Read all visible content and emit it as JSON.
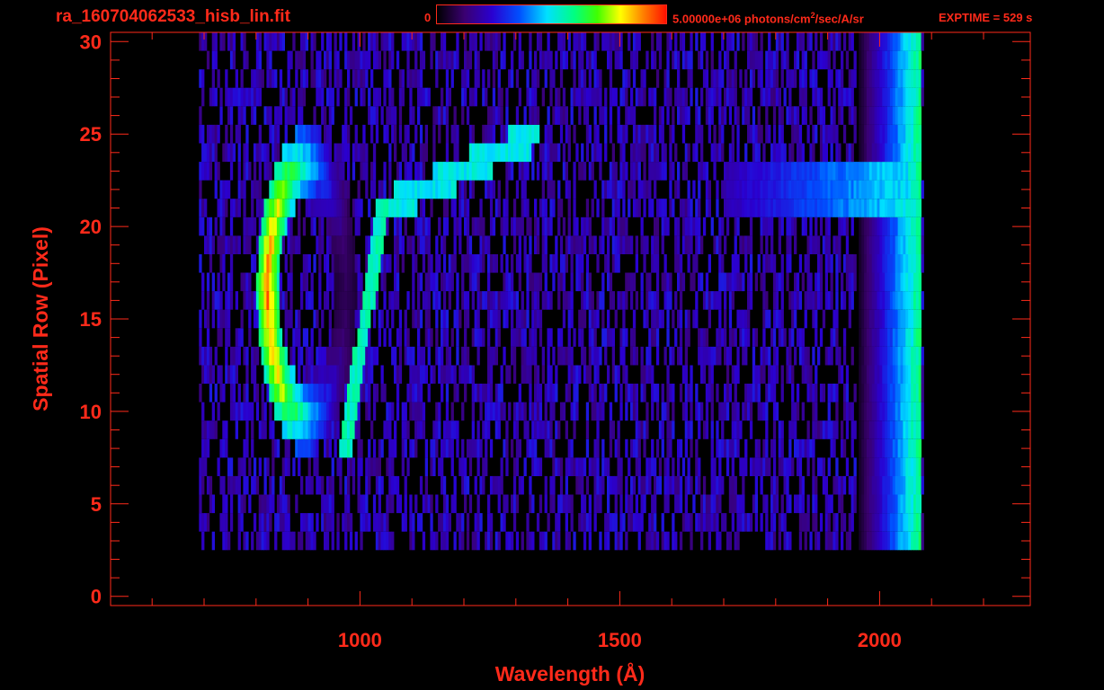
{
  "header": {
    "file_title": "ra_160704062533_hisb_lin.fit",
    "colorbar_min": "0",
    "colorbar_max_prefix": "5.00000e+06 photons/cm",
    "colorbar_max_sup": "2",
    "colorbar_max_suffix": "/sec/A/sr",
    "exptime": "EXPTIME = 529 s"
  },
  "colors": {
    "axis": "#ff2a1a",
    "background": "#000000",
    "colormap": [
      "#000000",
      "#3a0070",
      "#2a00d0",
      "#0050ff",
      "#00e0ff",
      "#00ff80",
      "#40ff00",
      "#ffff00",
      "#ff8000",
      "#ff1000"
    ]
  },
  "chart_data": {
    "type": "heatmap",
    "title": "ra_160704062533_hisb_lin.fit",
    "xlabel": "Wavelength (Å)",
    "ylabel": "Spatial Row (Pixel)",
    "xlim": [
      520,
      2290
    ],
    "ylim": [
      -0.5,
      30.5
    ],
    "xticks": [
      1000,
      1500,
      2000
    ],
    "yticks": [
      0,
      5,
      10,
      15,
      20,
      25,
      30
    ],
    "colorbar": {
      "min": 0,
      "max": 5000000,
      "units": "photons/cm^2/sec/A/sr"
    },
    "data_extent": {
      "wavelength": [
        690,
        2080
      ],
      "rows": [
        3,
        30
      ]
    },
    "emission_features": [
      {
        "name": "loop",
        "wavelength_center": 895,
        "row_center": 16.5,
        "row_span": [
          10,
          24
        ],
        "peak_level": 0.95
      },
      {
        "name": "diagonal-streak",
        "wavelength": [
          970,
          1040
        ],
        "rows": [
          8,
          21
        ],
        "peak_level": 0.55
      },
      {
        "name": "upper-band",
        "wavelength": [
          1050,
          1340
        ],
        "rows": [
          21,
          25
        ],
        "peak_level": 0.5
      },
      {
        "name": "row-22-band",
        "wavelength": [
          1700,
          2060
        ],
        "rows": [
          21,
          23
        ],
        "peak_level": 0.5
      },
      {
        "name": "red-edge",
        "wavelength": [
          1950,
          2075
        ],
        "rows": [
          0,
          30
        ],
        "peak_level": 0.6
      }
    ]
  }
}
